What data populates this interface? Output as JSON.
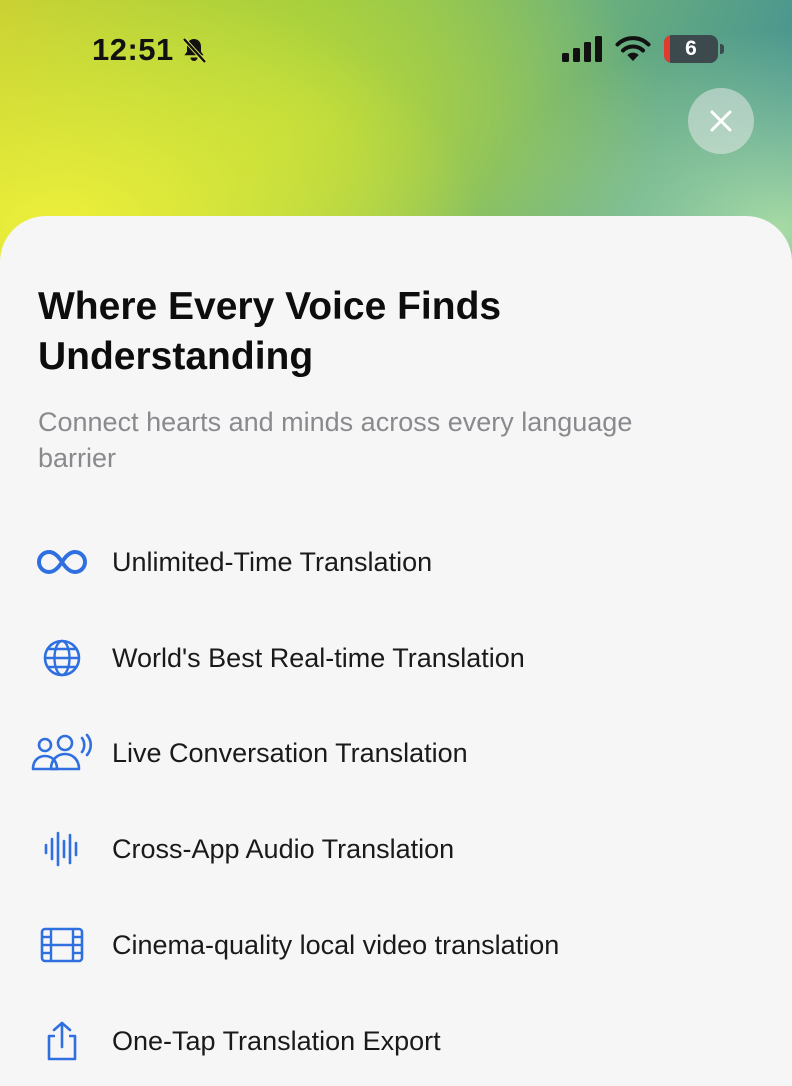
{
  "status_bar": {
    "time": "12:51",
    "battery_level": "6",
    "icons": [
      "bell-slash-icon",
      "cellular-signal-icon",
      "wifi-icon",
      "battery-icon"
    ]
  },
  "close_button": {
    "icon": "close-icon"
  },
  "header": {
    "title": "Where Every Voice Finds Understanding",
    "subtitle": "Connect hearts and minds across every language barrier"
  },
  "features": [
    {
      "icon": "infinity-icon",
      "label": "Unlimited-Time Translation"
    },
    {
      "icon": "globe-icon",
      "label": "World's Best Real-time Translation"
    },
    {
      "icon": "people-speaking-icon",
      "label": "Live Conversation Translation"
    },
    {
      "icon": "waveform-icon",
      "label": "Cross-App Audio Translation"
    },
    {
      "icon": "film-icon",
      "label": "Cinema-quality local video translation"
    },
    {
      "icon": "share-icon",
      "label": "One-Tap Translation Export"
    }
  ],
  "colors": {
    "accent": "#2f6fe0",
    "title": "#0d0d0d",
    "subtitle": "#8a8a8e",
    "battery_low": "#e23a2e",
    "sheet_background": "#f6f6f7"
  }
}
